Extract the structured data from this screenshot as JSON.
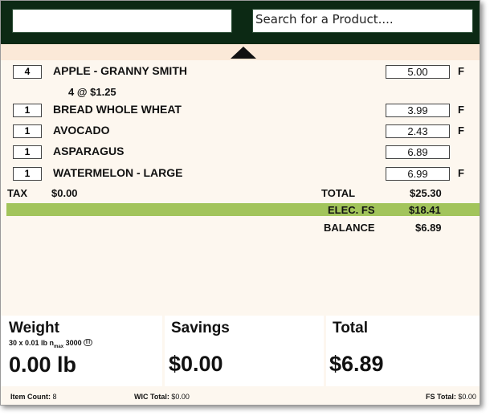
{
  "search": {
    "barcode_value": "",
    "product_search_value": "Search for a Product...."
  },
  "items": [
    {
      "qty": "4",
      "name": "APPLE - GRANNY SMITH",
      "price": "5.00",
      "fs": "F",
      "promo": "4 @ $1.25"
    },
    {
      "qty": "1",
      "name": "BREAD WHOLE WHEAT",
      "price": "3.99",
      "fs": "F"
    },
    {
      "qty": "1",
      "name": "AVOCADO",
      "price": "2.43",
      "fs": "F"
    },
    {
      "qty": "1",
      "name": "ASPARAGUS",
      "price": "6.89",
      "fs": ""
    },
    {
      "qty": "1",
      "name": "WATERMELON - LARGE",
      "price": "6.99",
      "fs": "F"
    }
  ],
  "totals": {
    "tax_label": "TAX",
    "tax_value": "$0.00",
    "total_label": "TOTAL",
    "total_value": "$25.30",
    "elec_fs_label": "ELEC. FS",
    "elec_fs_value": "$18.41",
    "balance_label": "BALANCE",
    "balance_value": "$6.89"
  },
  "panels": {
    "weight_title": "Weight",
    "scale_spec_prefix": "30 x 0.01 lb n",
    "scale_spec_sub": "max",
    "scale_spec_suffix": "3000",
    "scale_cert": "III",
    "weight_value": "0.00 lb",
    "savings_title": "Savings",
    "savings_value": "$0.00",
    "total_title": "Total",
    "total_value": "$6.89"
  },
  "footer": {
    "item_count_label": "Item Count:",
    "item_count_value": "8",
    "wic_total_label": "WIC Total:",
    "wic_total_value": "$0.00",
    "fs_total_label": "FS Total:",
    "fs_total_value": "$0.00"
  },
  "colors": {
    "header_bg": "#0c2914",
    "fs_bar": "#a2c45b",
    "panel_bg": "#ffffff",
    "body_bg": "#fdf7ef"
  }
}
